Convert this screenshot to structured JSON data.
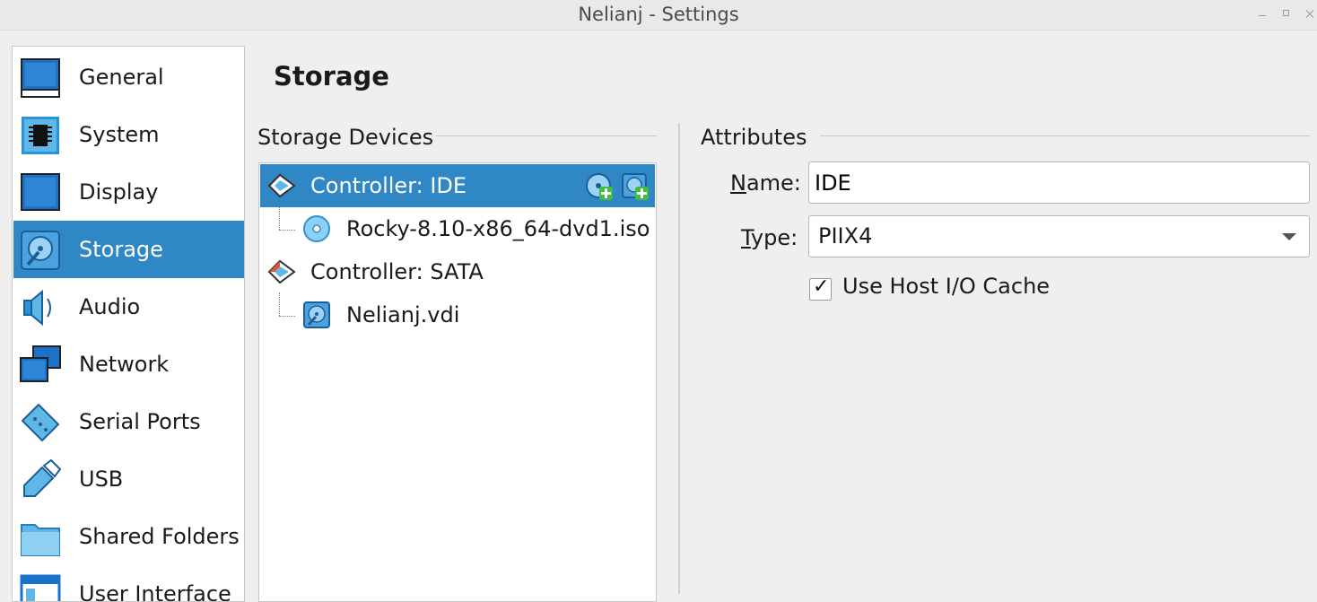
{
  "window": {
    "title": "Nelianj - Settings"
  },
  "sidebar": {
    "items": [
      {
        "label": "General",
        "icon": "general-icon",
        "selected": false
      },
      {
        "label": "System",
        "icon": "system-icon",
        "selected": false
      },
      {
        "label": "Display",
        "icon": "display-icon",
        "selected": false
      },
      {
        "label": "Storage",
        "icon": "storage-icon",
        "selected": true
      },
      {
        "label": "Audio",
        "icon": "audio-icon",
        "selected": false
      },
      {
        "label": "Network",
        "icon": "network-icon",
        "selected": false
      },
      {
        "label": "Serial Ports",
        "icon": "serial-ports-icon",
        "selected": false
      },
      {
        "label": "USB",
        "icon": "usb-icon",
        "selected": false
      },
      {
        "label": "Shared Folders",
        "icon": "shared-folders-icon",
        "selected": false
      },
      {
        "label": "User Interface",
        "icon": "user-interface-icon",
        "selected": false
      }
    ]
  },
  "page": {
    "title": "Storage"
  },
  "storage_devices": {
    "title": "Storage Devices",
    "tree": [
      {
        "label": "Controller: IDE",
        "type": "controller",
        "icon": "ide-controller-icon",
        "selected": true
      },
      {
        "label": "Rocky-8.10-x86_64-dvd1.iso",
        "type": "attachment",
        "icon": "optical-disc-icon",
        "selected": false
      },
      {
        "label": "Controller: SATA",
        "type": "controller",
        "icon": "sata-controller-icon",
        "selected": false
      },
      {
        "label": "Nelianj.vdi",
        "type": "attachment",
        "icon": "hard-disk-icon",
        "selected": false
      }
    ]
  },
  "attributes": {
    "title": "Attributes",
    "name_label": "ame:",
    "name_label_mnemonic": "N",
    "name_value": "IDE",
    "type_label": "ype:",
    "type_label_mnemonic": "T",
    "type_value": "PIIX4",
    "host_io_cache_label": "Use Host I/O Cache",
    "host_io_cache_checked": true,
    "checkmark": "✓"
  },
  "colors": {
    "selection": "#3087c5",
    "icon_blue": "#1a73c8",
    "icon_light_blue": "#5fb7e8",
    "add_green": "#3fbf3f"
  }
}
